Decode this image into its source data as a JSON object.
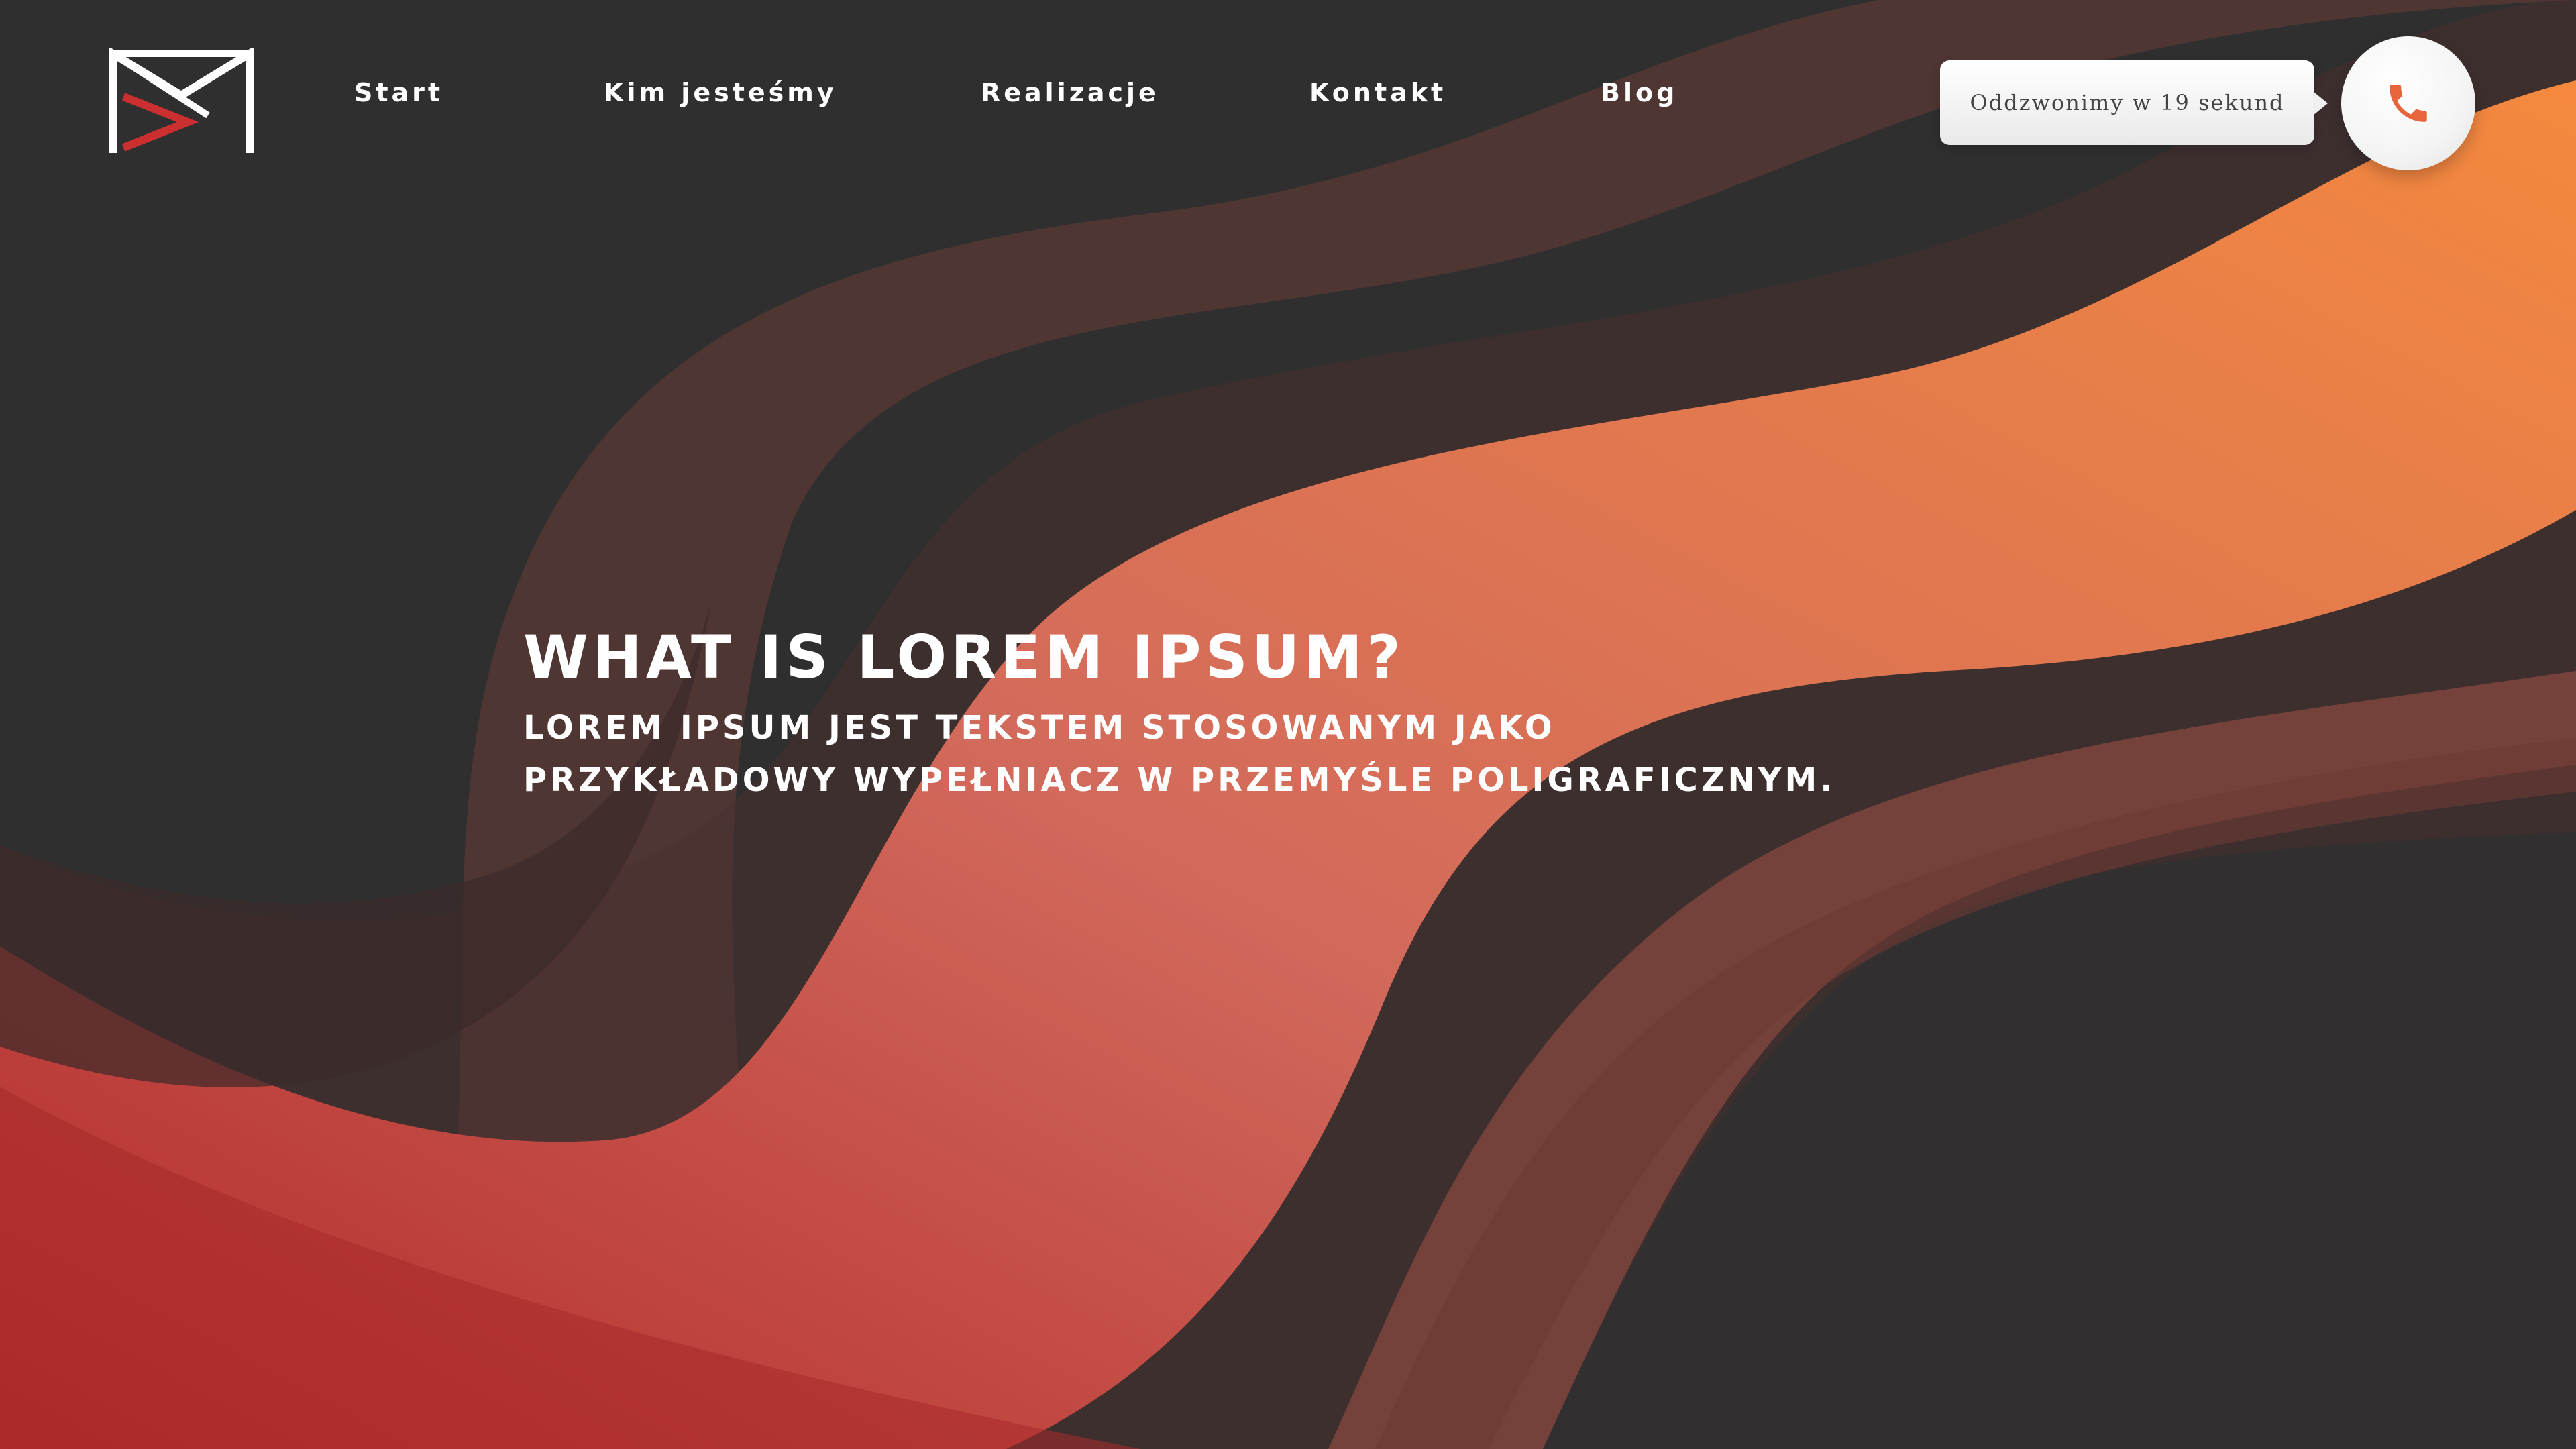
{
  "nav": {
    "items": [
      {
        "label": "Start"
      },
      {
        "label": "Kim jesteśmy"
      },
      {
        "label": "Realizacje"
      },
      {
        "label": "Kontakt"
      },
      {
        "label": "Blog"
      }
    ]
  },
  "callback": {
    "text": "Oddzwonimy w 19 sekund",
    "icon": "phone-icon"
  },
  "hero": {
    "title": "WHAT IS LOREM IPSUM?",
    "subtitle": "LOREM IPSUM JEST TEKSTEM STOSOWANYM JAKO PRZYKŁADOWY WYPEŁNIACZ W PRZEMYŚLE POLIGRAFICZNYM."
  },
  "colors": {
    "background": "#2f2f2f",
    "accent_red": "#b02a2a",
    "accent_orange": "#f08444",
    "text": "#ffffff"
  },
  "logo": {
    "icon": "brand-logo-icon"
  }
}
